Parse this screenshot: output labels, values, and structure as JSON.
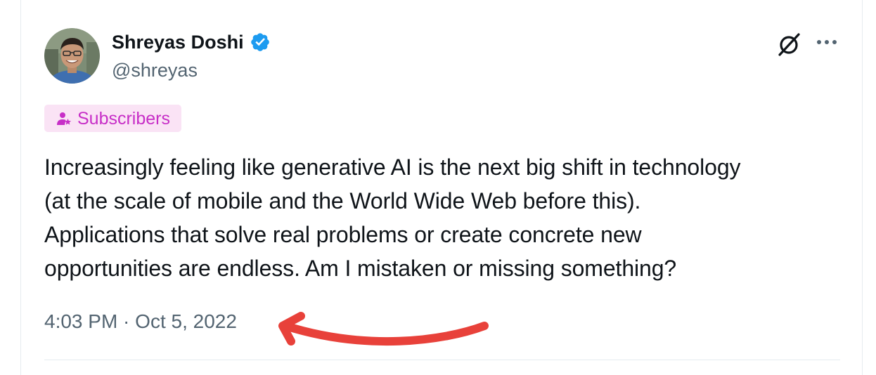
{
  "author": {
    "name": "Shreyas Doshi",
    "handle": "@shreyas",
    "verified": true,
    "avatar_icon": "profile-photo"
  },
  "badge": {
    "label": "Subscribers",
    "icon": "subscriber-star-icon",
    "text_color": "#c72ec7",
    "background": "#fae3f5"
  },
  "actions": {
    "grok_icon": "grok-icon",
    "more_icon": "more-horizontal-icon"
  },
  "tweet": {
    "lines": [
      "Increasingly feeling like generative AI is the next big shift in technology",
      "(at the scale of mobile and the World Wide Web before this).",
      "Applications that solve real problems or create concrete new",
      "opportunities are endless. Am I mistaken or missing something?"
    ],
    "timestamp": "4:03 PM · Oct 5, 2022"
  },
  "annotation": {
    "icon": "red-arrow-annotation",
    "color": "#e8413a"
  },
  "colors": {
    "verified": "#1d9bf0",
    "text": "#0f1419",
    "secondary": "#536471",
    "border": "#e6ebef"
  }
}
